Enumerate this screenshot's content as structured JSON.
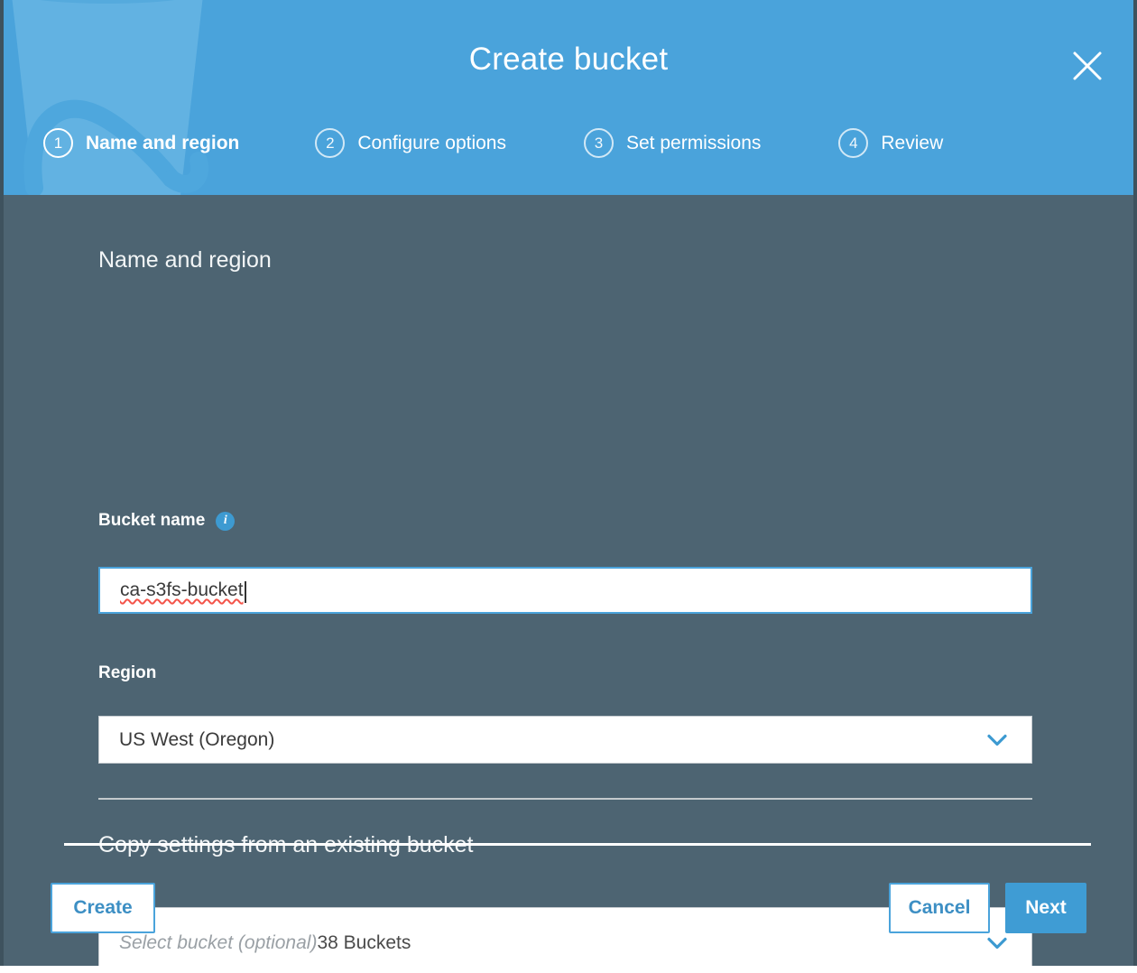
{
  "window": {
    "title": "Create bucket",
    "close_icon": "close-x-icon",
    "watermark_icon": "bucket-pail-watermark-icon",
    "accent_color": "#4aa3db",
    "body_color": "#4d6472"
  },
  "steps": [
    {
      "number": "1",
      "label": "Name and region",
      "active": true
    },
    {
      "number": "2",
      "label": "Configure options",
      "active": false
    },
    {
      "number": "3",
      "label": "Set permissions",
      "active": false
    },
    {
      "number": "4",
      "label": "Review",
      "active": false
    }
  ],
  "form": {
    "section_title": "Name and region",
    "bucket_name": {
      "label": "Bucket name",
      "info_icon": "info-icon",
      "value": "ca-s3fs-bucket",
      "placeholder": "Bucket name",
      "spellcheck_error": true
    },
    "region": {
      "label": "Region",
      "value": "US West (Oregon)",
      "chevron_icon": "chevron-down-icon"
    },
    "copy_settings": {
      "title": "Copy settings from an existing bucket",
      "placeholder": "Select bucket (optional)",
      "count_label": "38 Buckets",
      "chevron_icon": "chevron-down-icon"
    }
  },
  "footer": {
    "create_label": "Create",
    "cancel_label": "Cancel",
    "next_label": "Next"
  }
}
